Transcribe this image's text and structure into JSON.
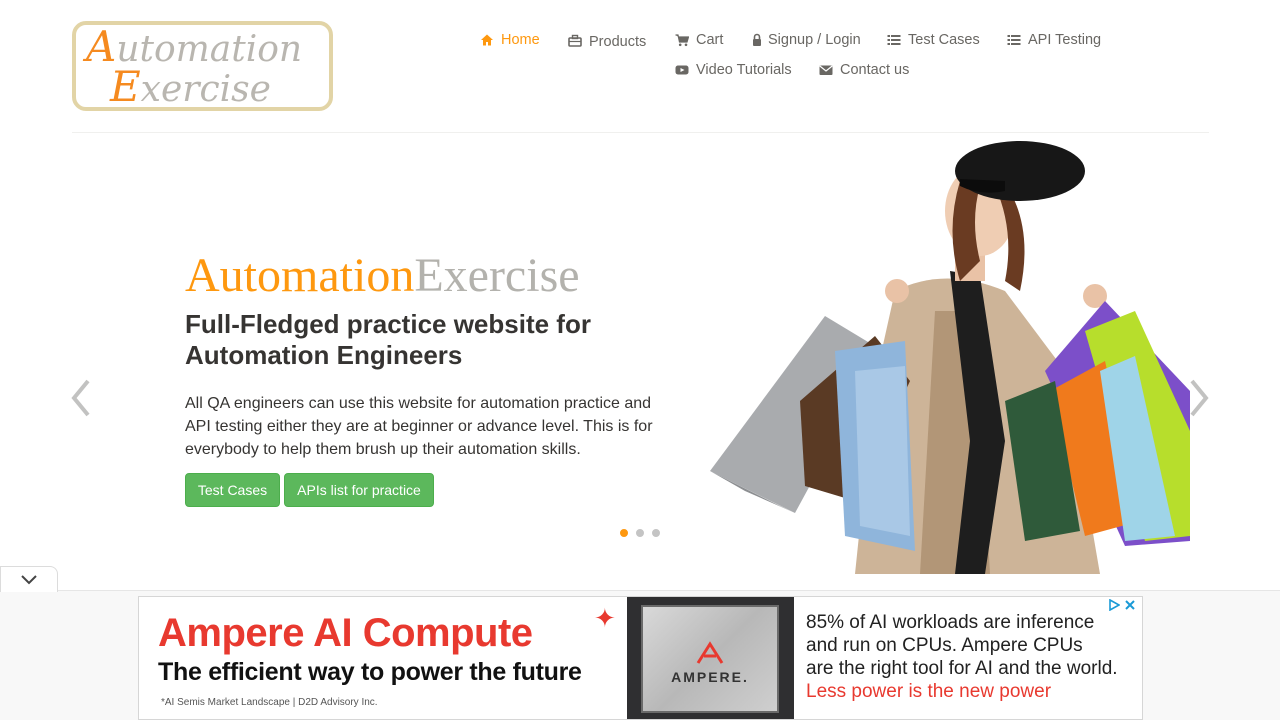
{
  "logo": {
    "line1_cap": "A",
    "line1_rest": "utomation",
    "line2_cap": "E",
    "line2_rest": "xercise"
  },
  "nav": {
    "home": "Home",
    "products": "Products",
    "cart": "Cart",
    "signup_login": "Signup / Login",
    "test_cases": "Test Cases",
    "api_testing": "API Testing",
    "video_tutorials": "Video Tutorials",
    "contact_us": "Contact us"
  },
  "hero": {
    "title_part1": "Automation",
    "title_part2": "Exercise",
    "subtitle": "Full-Fledged practice website for Automation Engineers",
    "description": "All QA engineers can use this website for automation practice and API testing either they are at beginner or advance level. This is for everybody to help them brush up their automation skills.",
    "btn_test_cases": "Test Cases",
    "btn_apis": "APIs list for practice",
    "active_slide": 1,
    "slide_count": 3
  },
  "ad": {
    "headline": "Ampere AI Compute",
    "tagline": "The efficient way to power the future",
    "fine_print": "*AI Semis Market Landscape | D2D Advisory Inc.",
    "chip_name": "AMPERE.",
    "right_line1": "85% of AI workloads are inference",
    "right_line2": "and run on CPUs. Ampere CPUs",
    "right_line3": "are the right tool for AI and the world.",
    "right_line4": "Less power is the new power"
  },
  "colors": {
    "accent": "#fe980f",
    "text": "#696763",
    "dark_text": "#363432",
    "button_green": "#5cb85c",
    "ad_red": "#e8392f"
  }
}
